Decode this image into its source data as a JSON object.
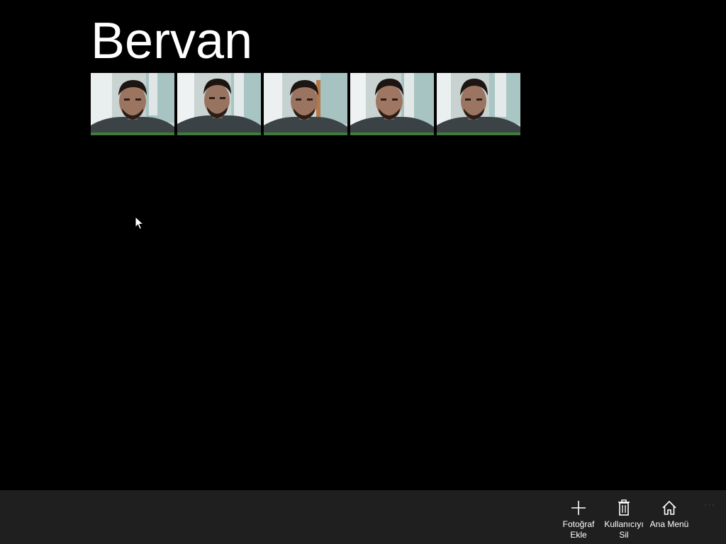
{
  "page": {
    "title": "Bervan"
  },
  "gallery": {
    "photos": [
      {
        "icon": "person-photo"
      },
      {
        "icon": "person-photo"
      },
      {
        "icon": "person-photo"
      },
      {
        "icon": "person-photo"
      },
      {
        "icon": "person-photo"
      }
    ]
  },
  "appbar": {
    "add_photo_label_line1": "Fotoğraf",
    "add_photo_label_line2": "Ekle",
    "delete_user_label_line1": "Kullanıcıyı",
    "delete_user_label_line2": "Sil",
    "home_label": "Ana Menü",
    "more_label": "···",
    "icons": {
      "add": "plus-icon",
      "delete": "trash-icon",
      "home": "home-icon",
      "more": "more-icon"
    },
    "colors": {
      "background": "#1f1f1f",
      "more_dots": "#6e2a2a"
    }
  }
}
